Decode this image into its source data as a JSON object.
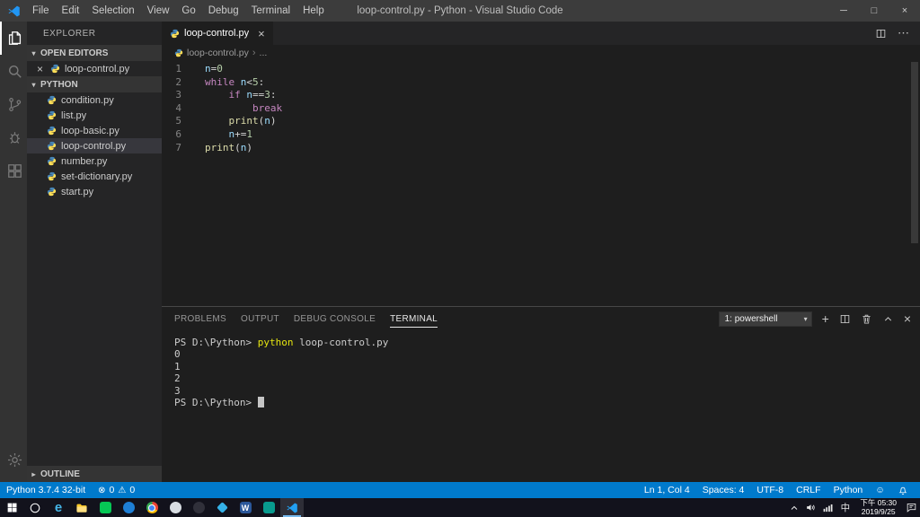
{
  "colors": {
    "statusbar": "#007acc",
    "titlebar": "#3c3c3c",
    "activitybar": "#333333",
    "sidebar": "#252526",
    "editor_background": "#1e1e1e",
    "syntax_keyword": "#c586c0",
    "syntax_number": "#b5cea8",
    "syntax_function": "#dcdcaa",
    "syntax_variable": "#9cdcfe",
    "selected_row": "#37373d",
    "taskbar_accent": "#76b9ed"
  },
  "titlebar": {
    "title": "loop-control.py - Python - Visual Studio Code",
    "menus": [
      "File",
      "Edit",
      "Selection",
      "View",
      "Go",
      "Debug",
      "Terminal",
      "Help"
    ],
    "window_controls": {
      "minimize": "─",
      "maximize": "□",
      "close": "×"
    }
  },
  "activity_bar": {
    "items": [
      {
        "name": "explorer",
        "active": true
      },
      {
        "name": "search",
        "active": false
      },
      {
        "name": "source-control",
        "active": false
      },
      {
        "name": "debug",
        "active": false
      },
      {
        "name": "extensions",
        "active": false
      }
    ],
    "bottom_items": [
      {
        "name": "settings",
        "active": false
      }
    ]
  },
  "sidebar": {
    "header": "EXPLORER",
    "open_editors_label": "OPEN EDITORS",
    "open_editors": [
      "loop-control.py"
    ],
    "folder_label": "PYTHON",
    "files": [
      "condition.py",
      "list.py",
      "loop-basic.py",
      "loop-control.py",
      "number.py",
      "set-dictionary.py",
      "start.py"
    ],
    "selected_file": "loop-control.py",
    "outline_label": "OUTLINE"
  },
  "editor": {
    "tab_label": "loop-control.py",
    "tab_close": "×",
    "breadcrumb_file": "loop-control.py",
    "breadcrumb_more": "...",
    "code_lines": [
      {
        "num": "1",
        "tokens": [
          [
            "v",
            "n"
          ],
          [
            "o",
            "="
          ],
          [
            "n",
            "0"
          ]
        ]
      },
      {
        "num": "2",
        "tokens": [
          [
            "k",
            "while"
          ],
          [
            "o",
            " "
          ],
          [
            "v",
            "n"
          ],
          [
            "o",
            "<"
          ],
          [
            "n",
            "5"
          ],
          [
            "o",
            ":"
          ]
        ]
      },
      {
        "num": "3",
        "tokens": [
          [
            "o",
            "    "
          ],
          [
            "k",
            "if"
          ],
          [
            "o",
            " "
          ],
          [
            "v",
            "n"
          ],
          [
            "o",
            "=="
          ],
          [
            "n",
            "3"
          ],
          [
            "o",
            ":"
          ]
        ]
      },
      {
        "num": "4",
        "tokens": [
          [
            "o",
            "        "
          ],
          [
            "k",
            "break"
          ]
        ]
      },
      {
        "num": "5",
        "tokens": [
          [
            "o",
            "    "
          ],
          [
            "f",
            "print"
          ],
          [
            "o",
            "("
          ],
          [
            "v",
            "n"
          ],
          [
            "o",
            ")"
          ]
        ]
      },
      {
        "num": "6",
        "tokens": [
          [
            "o",
            "    "
          ],
          [
            "v",
            "n"
          ],
          [
            "o",
            "+="
          ],
          [
            "n",
            "1"
          ]
        ]
      },
      {
        "num": "7",
        "tokens": [
          [
            "f",
            "print"
          ],
          [
            "o",
            "("
          ],
          [
            "v",
            "n"
          ],
          [
            "o",
            ")"
          ]
        ]
      }
    ]
  },
  "panel": {
    "tabs": [
      {
        "label": "PROBLEMS",
        "active": false
      },
      {
        "label": "OUTPUT",
        "active": false
      },
      {
        "label": "DEBUG CONSOLE",
        "active": false
      },
      {
        "label": "TERMINAL",
        "active": true
      }
    ],
    "terminal_picker": "1: powershell",
    "terminal_lines": [
      {
        "tokens": [
          [
            "plain",
            "PS D:\\Python> "
          ],
          [
            "cmd",
            "python"
          ],
          [
            "plain",
            " loop-control.py"
          ]
        ],
        "cursor": false
      },
      {
        "tokens": [
          [
            "plain",
            "0"
          ]
        ],
        "cursor": false
      },
      {
        "tokens": [
          [
            "plain",
            "1"
          ]
        ],
        "cursor": false
      },
      {
        "tokens": [
          [
            "plain",
            "2"
          ]
        ],
        "cursor": false
      },
      {
        "tokens": [
          [
            "plain",
            "3"
          ]
        ],
        "cursor": false
      },
      {
        "tokens": [
          [
            "plain",
            "PS D:\\Python> "
          ]
        ],
        "cursor": true
      }
    ]
  },
  "statusbar": {
    "interpreter": "Python 3.7.4 32-bit",
    "errors": "0",
    "warnings": "0",
    "right": [
      {
        "name": "cursor-position",
        "label": "Ln 1, Col 4"
      },
      {
        "name": "indentation",
        "label": "Spaces: 4"
      },
      {
        "name": "encoding",
        "label": "UTF-8"
      },
      {
        "name": "eol",
        "label": "CRLF"
      },
      {
        "name": "language-mode",
        "label": "Python"
      }
    ]
  },
  "taskbar": {
    "apps": [
      "start",
      "search",
      "edge",
      "file-explorer",
      "app-green",
      "app-blue",
      "chrome",
      "app-light",
      "app-dark",
      "app-diamond",
      "word",
      "app-teal",
      "vscode"
    ],
    "active_app": "vscode",
    "ime": "中",
    "time": "下午 05:30",
    "date": "2019/9/25"
  }
}
